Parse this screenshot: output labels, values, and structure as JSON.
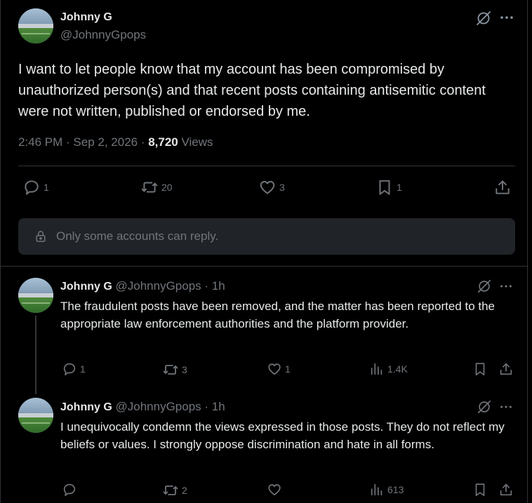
{
  "main_post": {
    "display_name": "Johnny G",
    "handle": "@JohnnyGpops",
    "text": "I want to let people know that my account has been compromised by unauthorized person(s) and that recent posts containing antisemitic content were not written, published or endorsed by me.",
    "timestamp": "2:46 PM · Sep 2, 2026 · ",
    "views_count": "8,720",
    "views_label": " Views",
    "replies": "1",
    "reposts": "20",
    "likes": "3",
    "bookmarks": "1",
    "reply_restriction": "Only some accounts can reply."
  },
  "replies": [
    {
      "display_name": "Johnny G",
      "handle_time": " @JohnnyGpops · 1h",
      "text": "The fraudulent posts have been removed, and the matter has been reported to the appropriate law enforcement authorities and the platform provider.",
      "replies": "1",
      "reposts": "3",
      "likes": "1",
      "views": "1.4K"
    },
    {
      "display_name": "Johnny G",
      "handle_time": " @JohnnyGpops · 1h",
      "text": "I unequivocally condemn the views expressed in those posts. They do not reflect my beliefs or values. I strongly oppose discrimination and hate in all forms.",
      "replies": "",
      "reposts": "2",
      "likes": "",
      "views": "613"
    }
  ],
  "icons": {
    "reply": "reply-icon",
    "repost": "repost-icon",
    "like": "heart-icon",
    "bookmark": "bookmark-icon",
    "share": "share-icon",
    "views": "views-icon",
    "grok": "grok-icon",
    "more": "more-icon",
    "lock": "lock-icon"
  }
}
